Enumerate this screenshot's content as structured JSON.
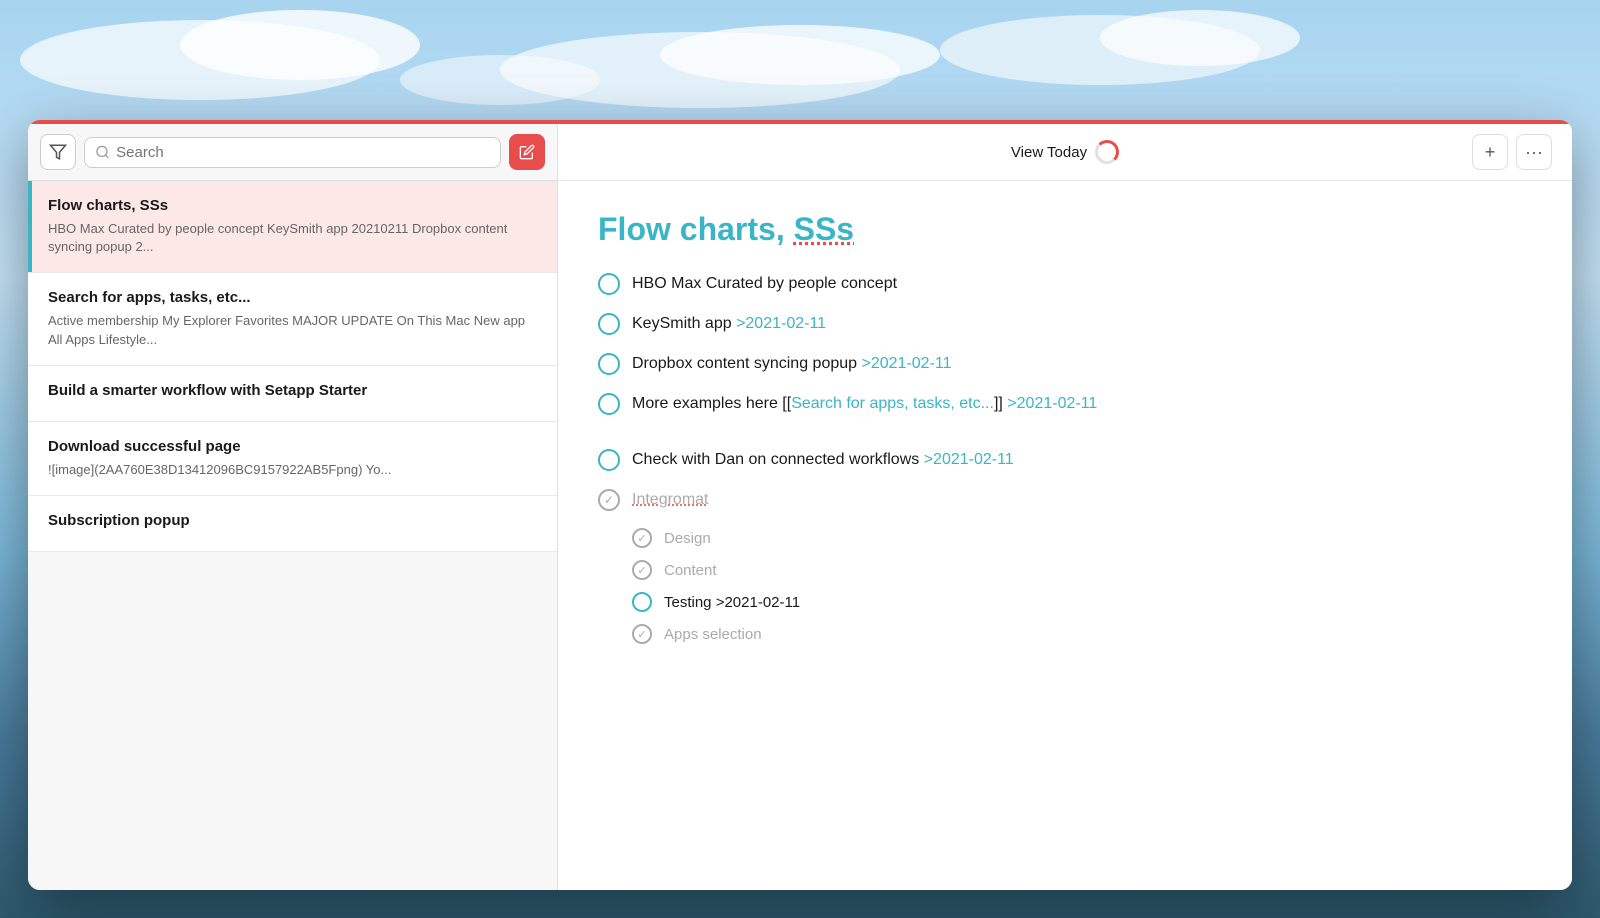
{
  "background": {
    "type": "sky-landscape"
  },
  "header": {
    "view_today_label": "View Today",
    "add_button_label": "+",
    "more_button_label": "···"
  },
  "sidebar": {
    "filter_tooltip": "Filter",
    "search_placeholder": "Search",
    "edit_tooltip": "Edit",
    "items": [
      {
        "id": "item-1",
        "title": "Flow charts, SSs",
        "preview": "HBO Max Curated by people concept KeySmith app 20210211 Dropbox content syncing popup 2...",
        "selected": true
      },
      {
        "id": "item-2",
        "title": "Search for apps, tasks, etc...",
        "preview": "Active membership My Explorer Favorites MAJOR UPDATE On This Mac New app All Apps Lifestyle...",
        "selected": false
      },
      {
        "id": "item-3",
        "title": "Build a smarter workflow with Setapp Starter",
        "preview": "",
        "selected": false
      },
      {
        "id": "item-4",
        "title": "Download successful page",
        "preview": "![image](2AA760E38D13412096BC9157922AB5Fpng) Yo...",
        "selected": false
      },
      {
        "id": "item-5",
        "title": "Subscription popup",
        "preview": "",
        "selected": false
      }
    ]
  },
  "note": {
    "title_part1": "Flow charts, ",
    "title_part2": "SSs",
    "tasks": [
      {
        "id": "t1",
        "text": "HBO Max Curated by people concept",
        "date": "",
        "completed": false
      },
      {
        "id": "t2",
        "text": "KeySmith app",
        "date": ">2021-02-11",
        "completed": false
      },
      {
        "id": "t3",
        "text": "Dropbox content syncing popup",
        "date": ">2021-02-11",
        "completed": false
      },
      {
        "id": "t4",
        "text_before": "More examples here [[",
        "link_text": "Search for apps, tasks, etc...",
        "text_after": "]]",
        "date": ">2021-02-11",
        "completed": false
      }
    ],
    "tasks2": [
      {
        "id": "t5",
        "text": "Check with Dan on connected workflows",
        "date": ">2021-02-11",
        "completed": false
      }
    ],
    "subtask_parent": {
      "text": "Integromat",
      "completed": true,
      "underlined": true
    },
    "subtasks": [
      {
        "id": "s1",
        "text": "Design",
        "completed": true
      },
      {
        "id": "s2",
        "text": "Content",
        "completed": true
      },
      {
        "id": "s3",
        "text": "Testing",
        "date": ">2021-02-11",
        "completed": false
      },
      {
        "id": "s4",
        "text": "Apps selection",
        "completed": true
      }
    ]
  }
}
